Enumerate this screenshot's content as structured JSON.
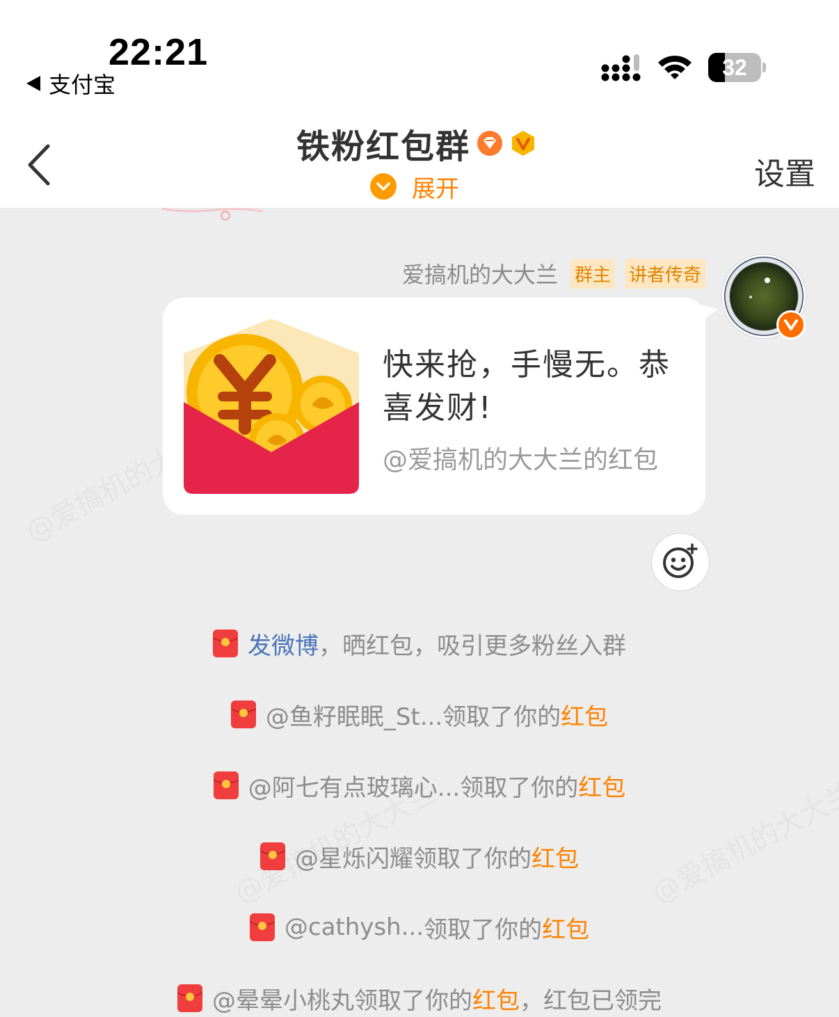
{
  "status_bar": {
    "time": "22:21",
    "back_app": "支付宝",
    "battery": "32",
    "battery_level": 0.32,
    "icons": [
      "signal-icon",
      "wifi-icon",
      "battery-icon"
    ]
  },
  "header": {
    "back_icon": "chevron-left-icon",
    "title": "铁粉红包群",
    "title_badges": [
      "diamond-badge-icon",
      "verified-v-badge-icon"
    ],
    "expand_label": "展开",
    "settings_label": "设置"
  },
  "watermark_text": "@爱搞机的大大兰",
  "message": {
    "sender": "爱搞机的大大兰",
    "tags": [
      "群主",
      "讲者传奇"
    ],
    "red_packet": {
      "text": "快来抢，手慢无。恭喜发财!",
      "from": "@爱搞机的大大兰的红包"
    }
  },
  "notices": [
    {
      "link": "发微博",
      "text": "，晒红包，吸引更多粉丝入群"
    },
    {
      "user": "@鱼籽眠眠_St...",
      "action": " 领取了你的",
      "highlight": "红包",
      "suffix": ""
    },
    {
      "user": "@阿七有点玻璃心...",
      "action": " 领取了你的",
      "highlight": "红包",
      "suffix": ""
    },
    {
      "user": "@星烁闪耀",
      "action": " 领取了你的",
      "highlight": "红包",
      "suffix": ""
    },
    {
      "user": "@cathysh...",
      "action": " 领取了你的",
      "highlight": "红包",
      "suffix": ""
    },
    {
      "user": "@晕晕小桃丸",
      "action": " 领取了你的",
      "highlight": "红包",
      "suffix": "，红包已领完"
    }
  ],
  "colors": {
    "accent_orange": "#ff8200",
    "link_blue": "#4a74b8",
    "red_packet_red": "#e5244a",
    "coin_yellow": "#f7b500",
    "background": "#ededed"
  }
}
